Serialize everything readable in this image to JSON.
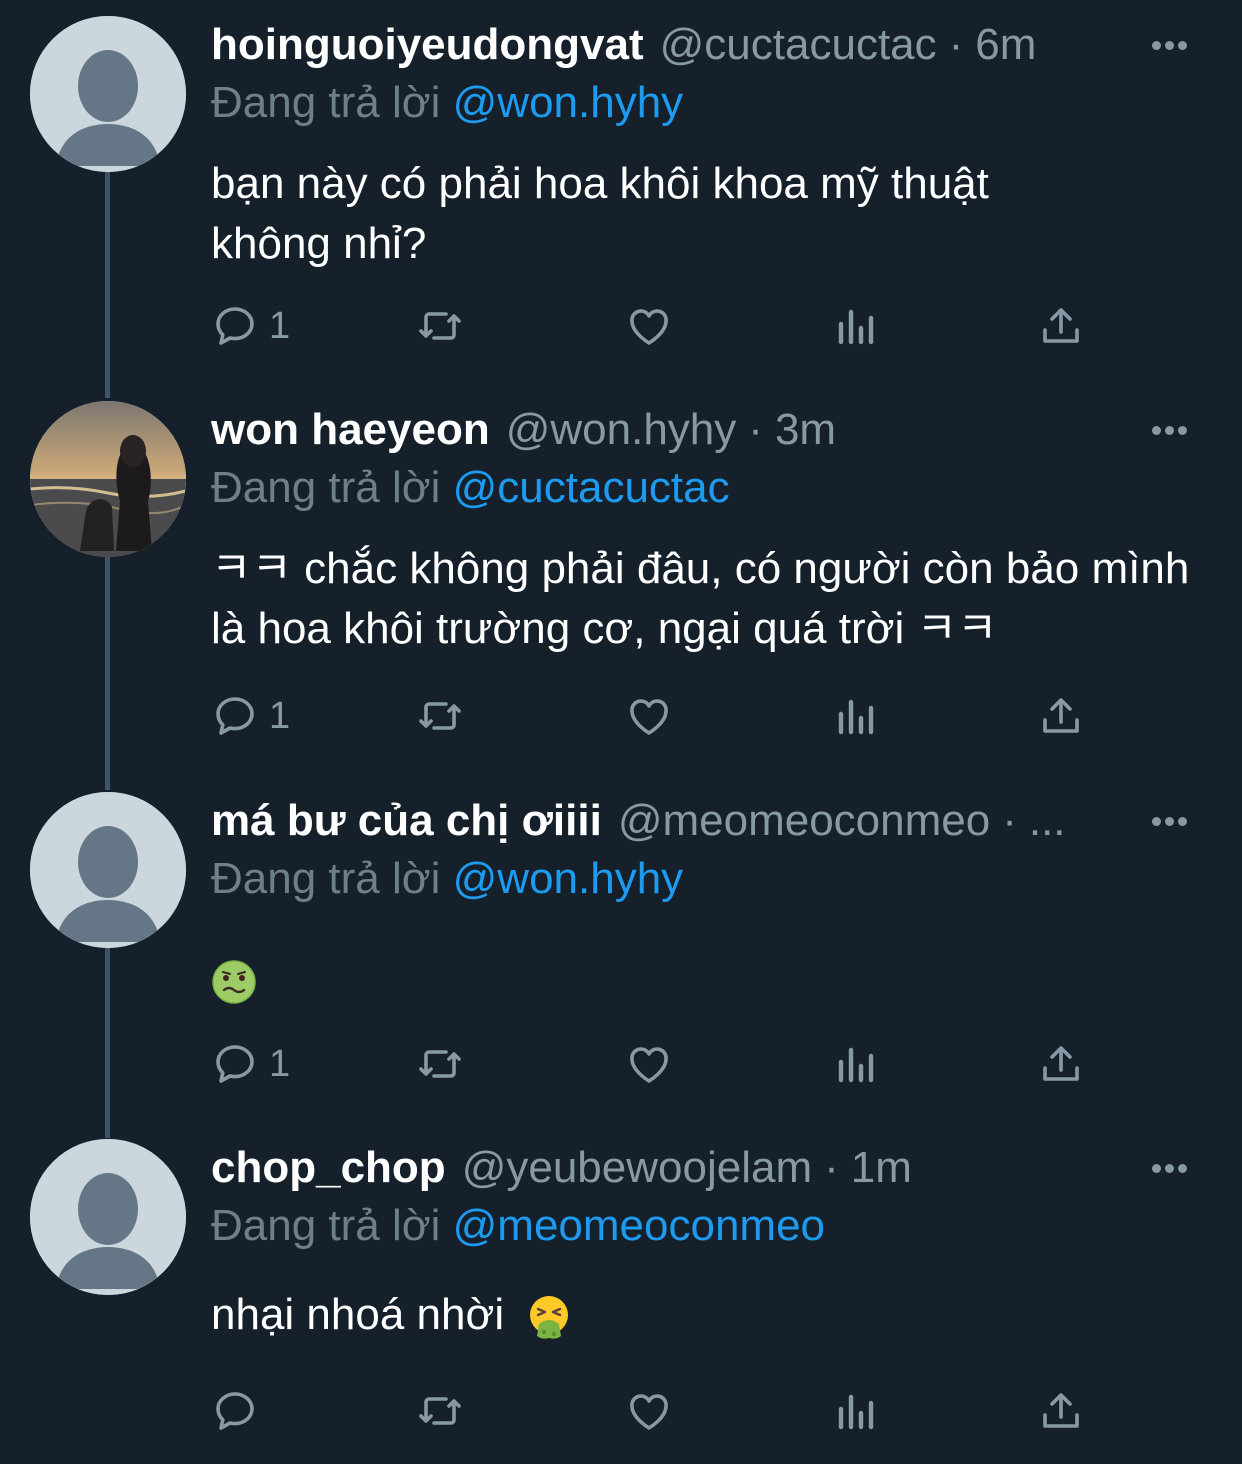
{
  "tweets": [
    {
      "display_name": "hoinguoiyeudongvat",
      "handle": "@cuctacuctac",
      "separator": "·",
      "time": "6m",
      "reply_prefix": "Đang trả lời",
      "reply_to": "@won.hyhy",
      "text": "bạn này có phải hoa khôi khoa mỹ thuật không nhỉ?",
      "reply_count": "1"
    },
    {
      "display_name": "won haeyeon",
      "handle": "@won.hyhy",
      "separator": "·",
      "time": "3m",
      "reply_prefix": "Đang trả lời",
      "reply_to": "@cuctacuctac",
      "text": "ㅋㅋ chắc không phải đâu, có người còn bảo mình là hoa khôi trường cơ, ngại quá trời ㅋㅋ",
      "reply_count": "1"
    },
    {
      "display_name": "má bư của chị ơiiii",
      "handle": "@meomeoconmeo",
      "separator": "·",
      "time": "...",
      "reply_prefix": "Đang trả lời",
      "reply_to": "@won.hyhy",
      "text": "",
      "emoji": "nauseated-face",
      "reply_count": "1"
    },
    {
      "display_name": "chop_chop",
      "handle": "@yeubewoojelam",
      "separator": "·",
      "time": "1m",
      "reply_prefix": "Đang trả lời",
      "reply_to": "@meomeoconmeo",
      "text": "nhại nhoá nhời",
      "emoji": "vomiting-face",
      "reply_count": ""
    }
  ],
  "icons": [
    "reply-icon",
    "retweet-icon",
    "like-icon",
    "analytics-icon",
    "share-icon",
    "more-icon"
  ],
  "colors": {
    "background": "#15202b",
    "text": "#ffffff",
    "secondary": "#8899a6",
    "mention": "#1d9bf0",
    "thread_line": "#3d5466",
    "avatar_bg": "#ccd6dd",
    "avatar_fg": "#657786"
  }
}
